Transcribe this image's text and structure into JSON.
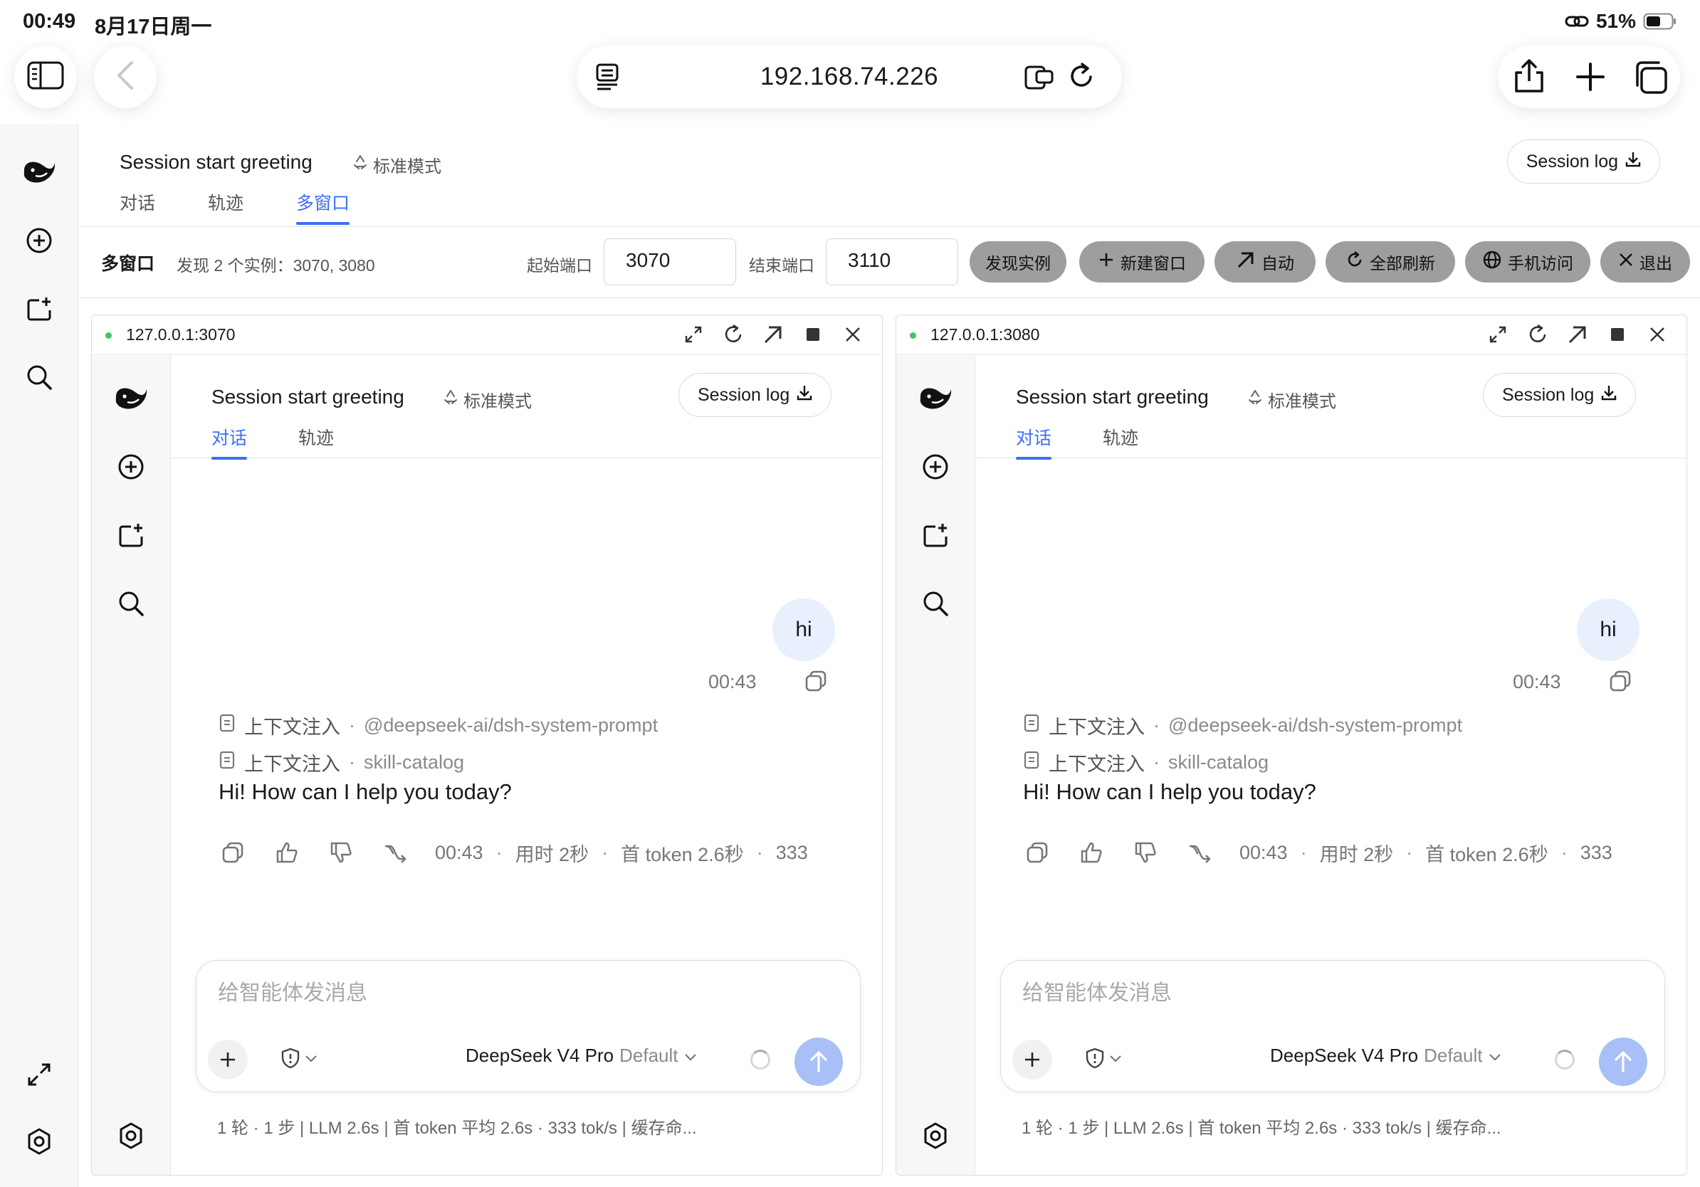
{
  "status_bar": {
    "time": "00:49",
    "date": "8月17日周一",
    "battery": "51%"
  },
  "browser": {
    "address": "192.168.74.226"
  },
  "app": {
    "title": "Session start greeting",
    "mode": "标准模式",
    "tabs": [
      "对话",
      "轨迹",
      "多窗口"
    ],
    "active_tab": "多窗口",
    "session_log": "Session log"
  },
  "controls": {
    "label": "多窗口",
    "found": "发现 2 个实例：3070, 3080",
    "start_port_label": "起始端口",
    "start_port": "3070",
    "end_port_label": "结束端口",
    "end_port": "3110",
    "buttons": [
      "发现实例",
      "新建窗口",
      "自动",
      "全部刷新",
      "手机访问",
      "退出"
    ]
  },
  "panes": [
    {
      "url": "127.0.0.1:3070",
      "title": "Session start greeting",
      "mode": "标准模式",
      "tabs": [
        "对话",
        "轨迹"
      ],
      "session_log": "Session log",
      "user_msg": "hi",
      "user_time": "00:43",
      "ctx1_label": "上下文注入",
      "ctx1_value": "@deepseek-ai/dsh-system-prompt",
      "ctx2_label": "上下文注入",
      "ctx2_value": "skill-catalog",
      "reply": "Hi! How can I help you today?",
      "reply_time": "00:43",
      "duration": "用时 2秒",
      "first_token": "首 token 2.6秒",
      "truncated": "333",
      "placeholder": "给智能体发消息",
      "model": "DeepSeek V4 Pro",
      "model_variant": "Default",
      "stats": "1 轮 · 1 步   |   LLM 2.6s   |   首 token 平均 2.6s · 333 tok/s   |   缓存命..."
    },
    {
      "url": "127.0.0.1:3080",
      "title": "Session start greeting",
      "mode": "标准模式",
      "tabs": [
        "对话",
        "轨迹"
      ],
      "session_log": "Session log",
      "user_msg": "hi",
      "user_time": "00:43",
      "ctx1_label": "上下文注入",
      "ctx1_value": "@deepseek-ai/dsh-system-prompt",
      "ctx2_label": "上下文注入",
      "ctx2_value": "skill-catalog",
      "reply": "Hi! How can I help you today?",
      "reply_time": "00:43",
      "duration": "用时 2秒",
      "first_token": "首 token 2.6秒",
      "truncated": "333",
      "placeholder": "给智能体发消息",
      "model": "DeepSeek V4 Pro",
      "model_variant": "Default",
      "stats": "1 轮 · 1 步   |   LLM 2.6s   |   首 token 平均 2.6s · 333 tok/s   |   缓存命..."
    }
  ],
  "colors": {
    "accent": "#3d6ef5",
    "button_gray": "#9e9e9e",
    "send": "#a9bff7",
    "online": "#3ec46d"
  },
  "icons": [
    "sidebar-icon",
    "back-icon",
    "reader-icon",
    "translate-icon",
    "reload-icon",
    "share-icon",
    "plus-icon",
    "tabs-icon",
    "whale-logo-icon",
    "new-chat-icon",
    "new-folder-icon",
    "search-icon",
    "expand-icon",
    "settings-icon"
  ]
}
